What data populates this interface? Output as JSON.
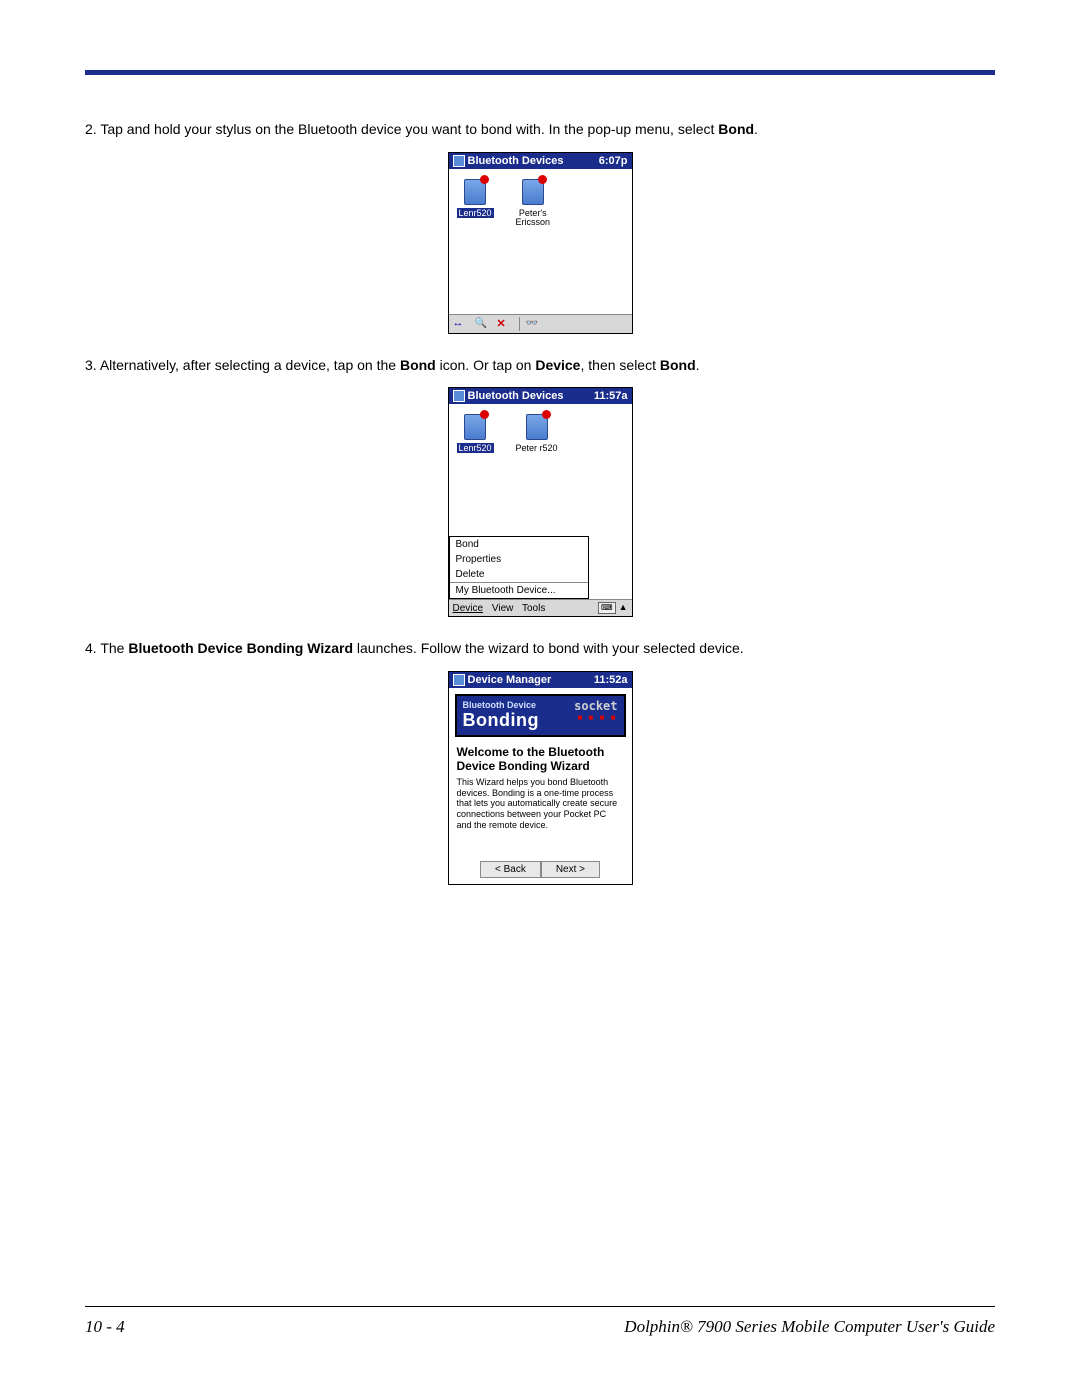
{
  "steps": {
    "s2": {
      "num": "2.",
      "text_a": "Tap and hold your stylus on the Bluetooth device you want to bond with. In the pop-up menu, select ",
      "bold_a": "Bond",
      "tail_a": "."
    },
    "s3": {
      "num": "3.",
      "text_a": "Alternatively, after selecting a device, tap on the ",
      "bold_a": "Bond",
      "text_b": " icon. Or tap on ",
      "bold_b": "Device",
      "text_c": ", then select ",
      "bold_c": "Bond",
      "tail": "."
    },
    "s4": {
      "num": "4.",
      "text_a": "The ",
      "bold_a": "Bluetooth Device Bonding Wizard",
      "text_b": " launches. Follow the wizard to bond with your selected device."
    }
  },
  "shot1": {
    "title": "Bluetooth Devices",
    "time": "6:07p",
    "device1": "Lenr520",
    "device2a": "Peter's",
    "device2b": "Ericsson"
  },
  "shot2": {
    "title": "Bluetooth Devices",
    "time": "11:57a",
    "device1": "Lenr520",
    "device2": "Peter r520",
    "menu": {
      "bond": "Bond",
      "properties": "Properties",
      "delete": "Delete",
      "mydevice": "My Bluetooth Device..."
    },
    "menubar": {
      "device": "Device",
      "view": "View",
      "tools": "Tools"
    }
  },
  "shot3": {
    "title": "Device Manager",
    "time": "11:52a",
    "banner_small": "Bluetooth Device",
    "banner_big": "Bonding",
    "socket": "socket",
    "welcome": "Welcome to the Bluetooth Device Bonding Wizard",
    "desc": "This Wizard helps you bond Bluetooth devices. Bonding is a one-time process that lets you automatically create secure connections between your Pocket PC and the remote device.",
    "back": "< Back",
    "next": "Next >"
  },
  "footer": {
    "pagenum": "10 - 4",
    "guide": "Dolphin® 7900 Series Mobile Computer User's Guide"
  }
}
